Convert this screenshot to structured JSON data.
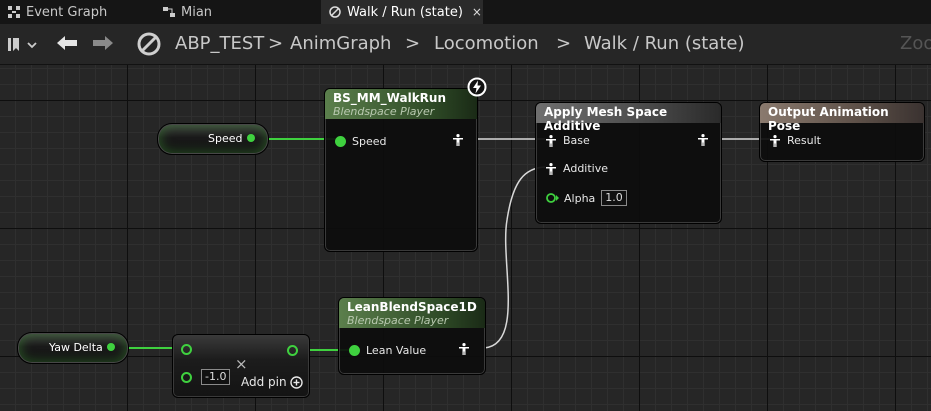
{
  "tabs": [
    {
      "label": "Event Graph",
      "icon": "event-graph-icon",
      "active": false
    },
    {
      "label": "Mian",
      "icon": "anim-graph-icon",
      "active": false
    },
    {
      "label": "Walk / Run (state)",
      "icon": "state-icon",
      "active": true,
      "close": "×"
    }
  ],
  "breadcrumb": {
    "items": [
      "ABP_TEST",
      "AnimGraph",
      "Locomotion",
      "Walk / Run (state)"
    ],
    "separator": ">",
    "zoom_label": "Zoo"
  },
  "nodes": {
    "speed_var": {
      "label": "Speed"
    },
    "yaw_var": {
      "label": "Yaw Delta"
    },
    "walkrun": {
      "title": "BS_MM_WalkRun",
      "subtitle": "Blendspace Player",
      "pin": "Speed"
    },
    "apply_additive": {
      "title": "Apply Mesh Space Additive",
      "base": "Base",
      "additive": "Additive",
      "alpha_label": "Alpha",
      "alpha_value": "1.0"
    },
    "output_pose": {
      "title": "Output Animation Pose",
      "result": "Result"
    },
    "lean": {
      "title": "LeanBlendSpace1D",
      "subtitle": "Blendspace Player",
      "pin": "Lean Value"
    },
    "multiply": {
      "value": "-1.0",
      "add_pin": "Add pin",
      "remove": "×"
    }
  },
  "colors": {
    "float_pin": "#3fd13f",
    "blendspace_header": "#5b7f4c",
    "additive_header": "#6f6f6f",
    "output_header": "#8a7a6e",
    "exec_wire": "#d8d8d8"
  }
}
